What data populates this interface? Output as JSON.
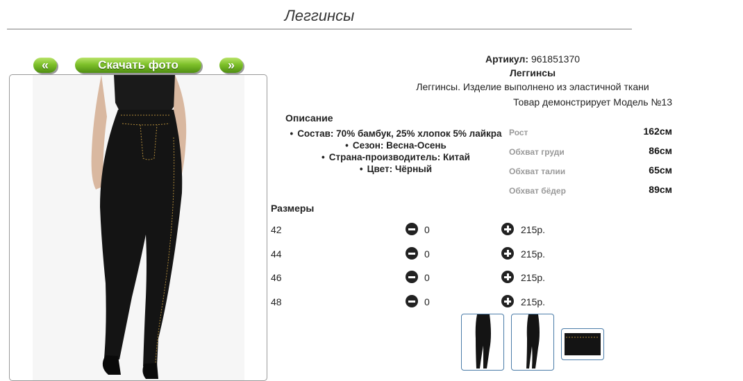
{
  "page": {
    "title": "Леггинсы"
  },
  "nav": {
    "prev_label": "«",
    "download_label": "Скачать фото",
    "next_label": "»"
  },
  "product": {
    "article_label": "Артикул:",
    "article_value": "961851370",
    "name": "Леггинсы",
    "description": "Леггинсы. Изделие выполнено из эластичной ткани",
    "model_note": "Товар демонстрирует Модель №13"
  },
  "description": {
    "heading": "Описание",
    "items": [
      "Состав: 70% бамбук, 25% хлопок 5% лайкра",
      "Сезон: Весна-Осень",
      "Страна-производитель: Китай",
      "Цвет: Чёрный"
    ]
  },
  "measurements": [
    {
      "label": "Рост",
      "value": "162см"
    },
    {
      "label": "Обхват груди",
      "value": "86см"
    },
    {
      "label": "Обхват талии",
      "value": "65см"
    },
    {
      "label": "Обхват бёдер",
      "value": "89см"
    }
  ],
  "sizes": {
    "heading": "Размеры",
    "rows": [
      {
        "size": "42",
        "qty": "0",
        "price": "215р."
      },
      {
        "size": "44",
        "qty": "0",
        "price": "215р."
      },
      {
        "size": "46",
        "qty": "0",
        "price": "215р."
      },
      {
        "size": "48",
        "qty": "0",
        "price": "215р."
      }
    ]
  },
  "colors": {
    "button_green": "#7ec12a",
    "thumb_border": "#4a7ca8",
    "garment": "#141414",
    "stitch": "#b08a3a"
  }
}
